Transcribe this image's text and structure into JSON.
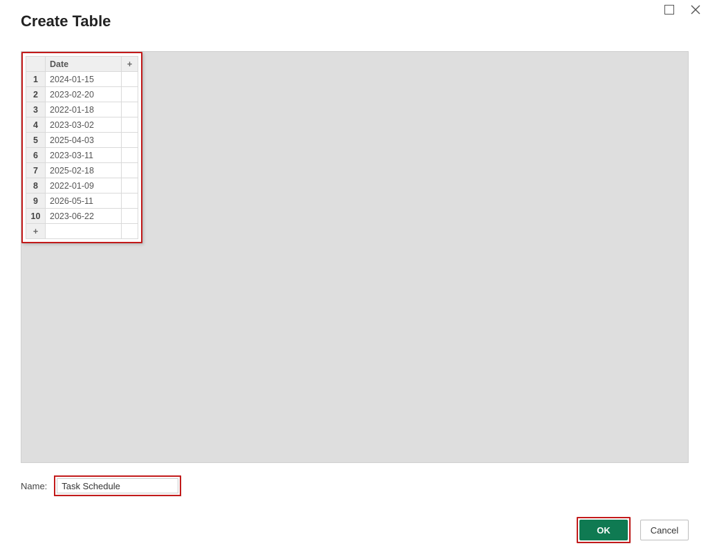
{
  "dialog": {
    "title": "Create Table"
  },
  "table": {
    "header": "Date",
    "add_col_label": "+",
    "add_row_label": "+",
    "rows": [
      {
        "n": "1",
        "date": "2024-01-15"
      },
      {
        "n": "2",
        "date": "2023-02-20"
      },
      {
        "n": "3",
        "date": "2022-01-18"
      },
      {
        "n": "4",
        "date": "2023-03-02"
      },
      {
        "n": "5",
        "date": "2025-04-03"
      },
      {
        "n": "6",
        "date": "2023-03-11"
      },
      {
        "n": "7",
        "date": "2025-02-18"
      },
      {
        "n": "8",
        "date": "2022-01-09"
      },
      {
        "n": "9",
        "date": "2026-05-11"
      },
      {
        "n": "10",
        "date": "2023-06-22"
      }
    ]
  },
  "name_field": {
    "label": "Name:",
    "value": "Task Schedule"
  },
  "buttons": {
    "ok": "OK",
    "cancel": "Cancel"
  }
}
